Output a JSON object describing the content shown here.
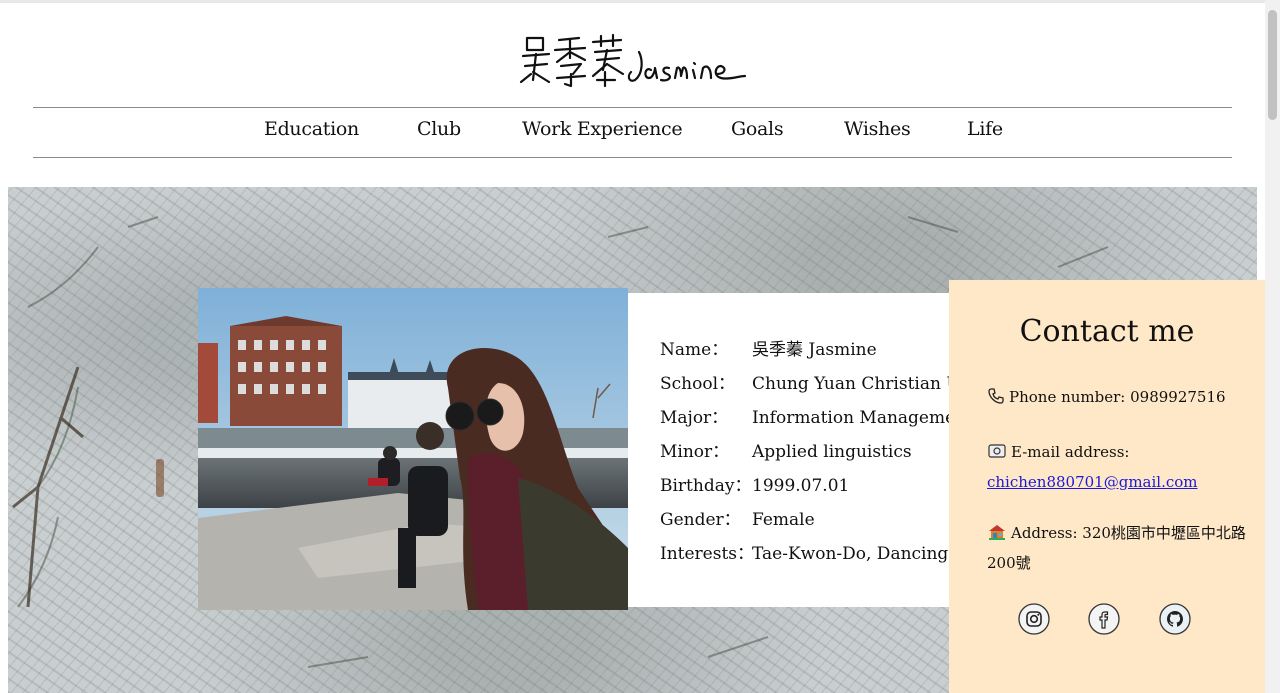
{
  "brand": {
    "logo_text": "吳季蓁 Jasmine"
  },
  "nav": {
    "items": [
      {
        "label": "Education"
      },
      {
        "label": "Club"
      },
      {
        "label": "Work Experience"
      },
      {
        "label": "Goals"
      },
      {
        "label": "Wishes"
      },
      {
        "label": "Life"
      }
    ]
  },
  "profile": {
    "rows": [
      {
        "label": "Name：",
        "value": "吳季蓁 Jasmine"
      },
      {
        "label": "School：",
        "value": "Chung Yuan Christian University"
      },
      {
        "label": "Major：",
        "value": "Information Management"
      },
      {
        "label": "Minor：",
        "value": "Applied linguistics"
      },
      {
        "label": "Birthday：",
        "value": "1999.07.01"
      },
      {
        "label": "Gender：",
        "value": "Female"
      },
      {
        "label": "Interests：",
        "value": "Tae-Kwon-Do, Dancing, Travel"
      }
    ]
  },
  "contact": {
    "title": "Contact me",
    "phone": "Phone number: 0989927516",
    "email_label": "E-mail address:",
    "email": "chichen880701@gmail.com",
    "address": "Address: 320桃園市中壢區中北路200號",
    "socials": [
      {
        "icon": "instagram-icon"
      },
      {
        "icon": "facebook-icon"
      },
      {
        "icon": "github-icon"
      }
    ]
  },
  "colors": {
    "contact_bg": "#ffe8c8",
    "link": "#1a1ad8"
  }
}
